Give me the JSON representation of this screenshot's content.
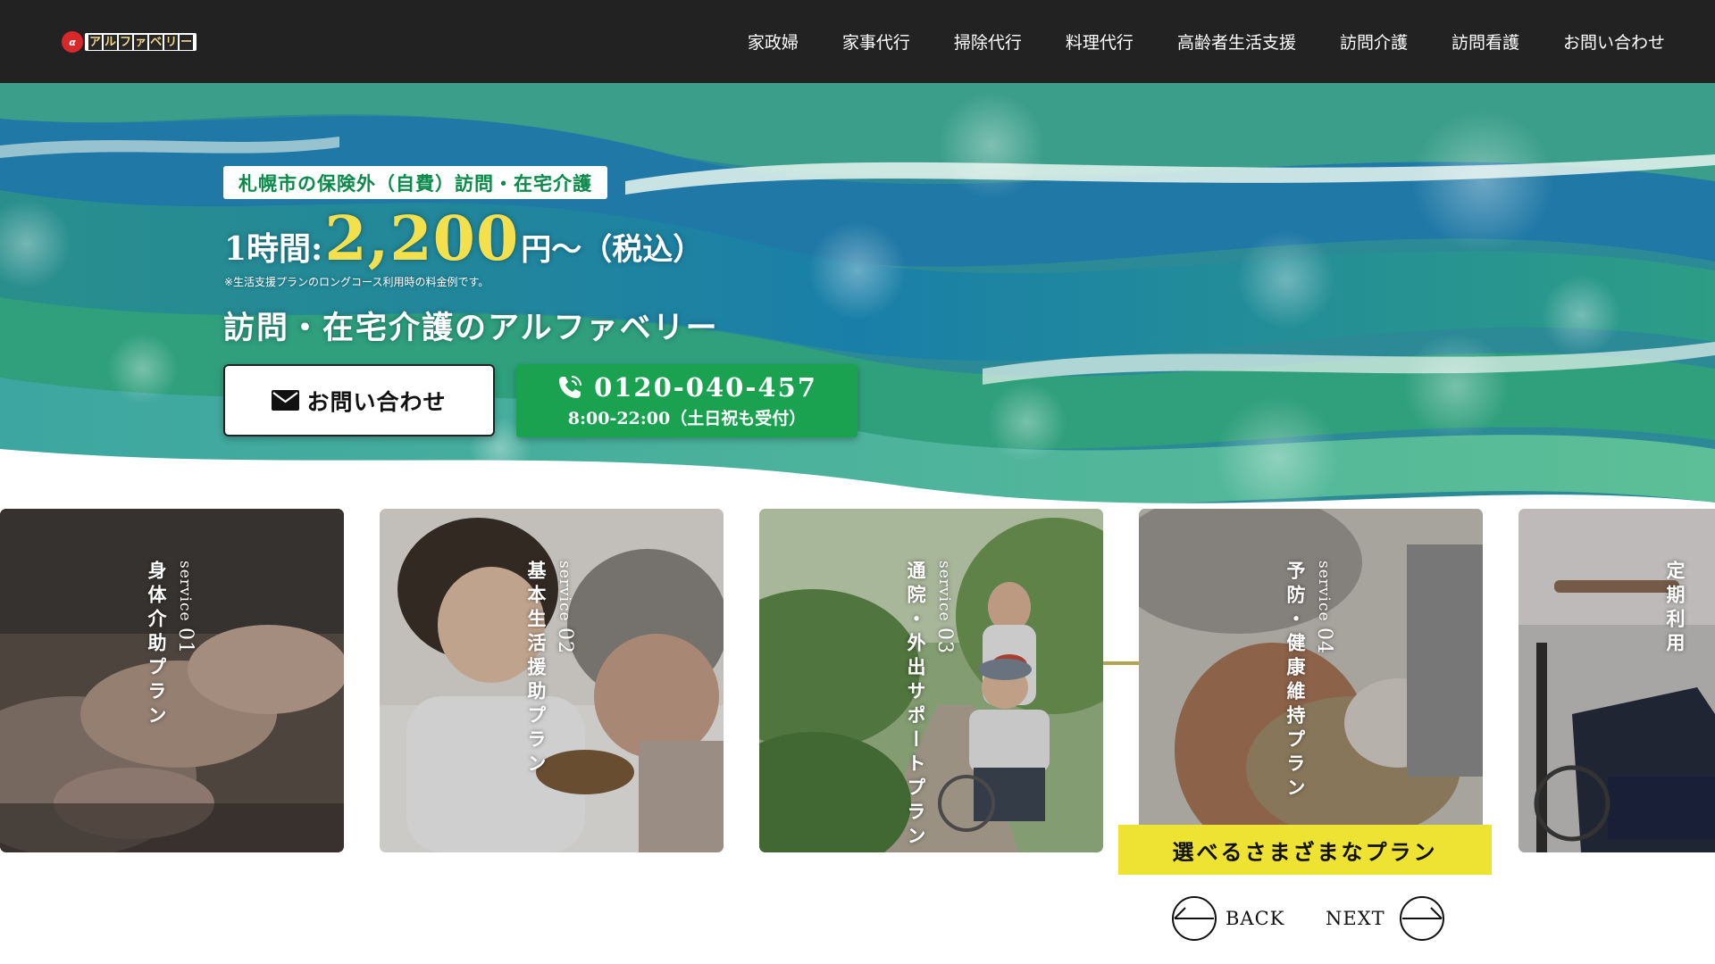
{
  "header": {
    "logo_text": "アルファベリー",
    "logo_letters": [
      "ア",
      "ル",
      "フ",
      "ァ",
      "ベ",
      "リ",
      "ー"
    ],
    "nav": [
      "家政婦",
      "家事代行",
      "掃除代行",
      "料理代行",
      "高齢者生活支援",
      "訪問介護",
      "訪問看護",
      "お問い合わせ"
    ]
  },
  "hero": {
    "tagline": "札幌市の保険外（自費）訪問・在宅介護",
    "price_prefix": "1時間:",
    "price_amount": "2,200",
    "price_suffix": "円〜（税込）",
    "price_note": "※生活支援プランのロングコース利用時の料金例です。",
    "catchcopy": "訪問・在宅介護のアルファベリー",
    "contact_button": "お問い合わせ",
    "phone_number": "0120-040-457",
    "phone_hours": "8:00-22:00（土日祝も受付）"
  },
  "services": [
    {
      "number_prefix": "service",
      "number": "01",
      "title": "身体介助プラン"
    },
    {
      "number_prefix": "service",
      "number": "02",
      "title": "基本生活援助プラン"
    },
    {
      "number_prefix": "service",
      "number": "03",
      "title": "通院・外出サポートプラン"
    },
    {
      "number_prefix": "service",
      "number": "04",
      "title": "予防・健康維持プラン"
    },
    {
      "title": "定期利用"
    }
  ],
  "carousel": {
    "banner": "選べるさまざまなプラン",
    "back": "BACK",
    "next": "NEXT"
  },
  "colors": {
    "header_bg": "#222222",
    "accent_green": "#1aa251",
    "tagline_green": "#0b8a4b",
    "price_yellow": "#f4e04d",
    "banner_yellow": "#eee233"
  }
}
